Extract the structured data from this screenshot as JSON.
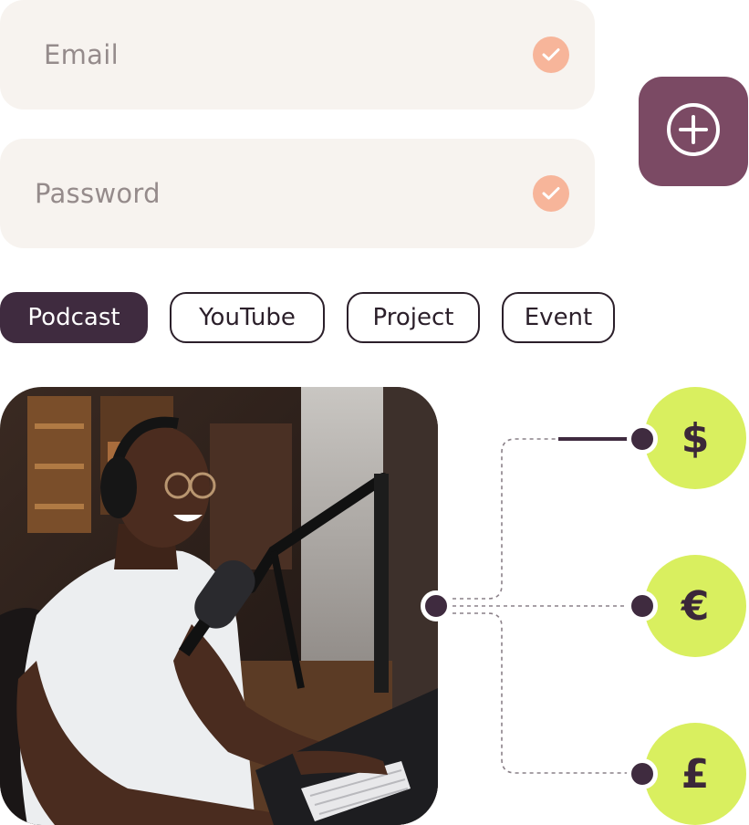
{
  "form": {
    "email_label": "Email",
    "password_label": "Password"
  },
  "tags": [
    {
      "label": "Podcast"
    },
    {
      "label": "YouTube"
    },
    {
      "label": "Project"
    },
    {
      "label": "Event"
    }
  ],
  "currencies": [
    {
      "symbol": "$"
    },
    {
      "symbol": "€"
    },
    {
      "symbol": "£"
    }
  ],
  "colors": {
    "field_bg": "#f7f3ef",
    "check": "#f7b59a",
    "brand": "#7b4a64",
    "dark": "#3f2b3f",
    "lime": "#d9ef5f"
  },
  "icons": {
    "add": "plus-circle-icon",
    "check": "check-icon"
  }
}
